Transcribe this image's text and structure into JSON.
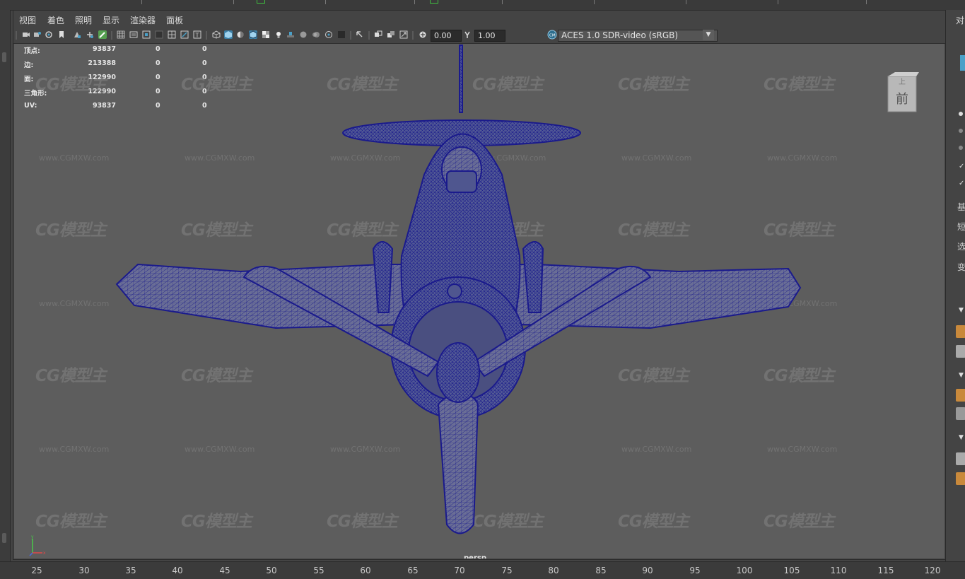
{
  "menu": [
    "视图",
    "着色",
    "照明",
    "显示",
    "渲染器",
    "面板"
  ],
  "toolbar": {
    "exposure_value": "0.00",
    "gamma_value": "1.00",
    "color_management": "ACES 1.0 SDR-video (sRGB)",
    "icons": [
      "select-camera-icon",
      "camera-attributes-icon",
      "bookmark-icon",
      "image-plane-icon",
      "2d-pan-zoom-icon",
      "grease-pencil-icon",
      "grid-icon",
      "film-gate-icon",
      "resolution-gate-icon",
      "gate-mask-icon",
      "field-chart-icon",
      "safe-action-icon",
      "safe-title-icon",
      "wireframe-icon",
      "smooth-shade-icon",
      "default-material-icon",
      "wireframe-on-shaded-icon",
      "textured-icon",
      "use-all-lights-icon",
      "shadows-icon",
      "screen-space-ao-icon",
      "motion-blur-icon",
      "anti-aliasing-icon",
      "depth-of-field-icon",
      "isolate-select-icon",
      "xray-icon",
      "xray-joints-icon",
      "backface-culling-icon",
      "exposure-icon",
      "gamma-icon",
      "color-management-icon"
    ]
  },
  "hud": [
    {
      "label": "顶点:",
      "v1": "93837",
      "v2": "0",
      "v3": "0"
    },
    {
      "label": "边:",
      "v1": "213388",
      "v2": "0",
      "v3": "0"
    },
    {
      "label": "面:",
      "v1": "122990",
      "v2": "0",
      "v3": "0"
    },
    {
      "label": "三角形:",
      "v1": "122990",
      "v2": "0",
      "v3": "0"
    },
    {
      "label": "UV:",
      "v1": "93837",
      "v2": "0",
      "v3": "0"
    }
  ],
  "viewcube": {
    "top": "上",
    "front": "前"
  },
  "camera_label": "persp",
  "watermark": {
    "logo": "CG模型主",
    "url": "www.CGMXW.com"
  },
  "right_panel": {
    "title": "对",
    "labels": [
      "基",
      "短",
      "选",
      "变"
    ]
  },
  "timeline": {
    "ticks": [
      "25",
      "30",
      "35",
      "40",
      "45",
      "50",
      "55",
      "60",
      "65",
      "70",
      "75",
      "80",
      "85",
      "90",
      "95",
      "100",
      "105",
      "110",
      "115",
      "120"
    ]
  },
  "colors": {
    "viewport_bg": "#5d5d5d",
    "wireframe": "#1a1a8c",
    "panel_bg": "#444444",
    "highlight_icon": "#4aa0c8"
  }
}
